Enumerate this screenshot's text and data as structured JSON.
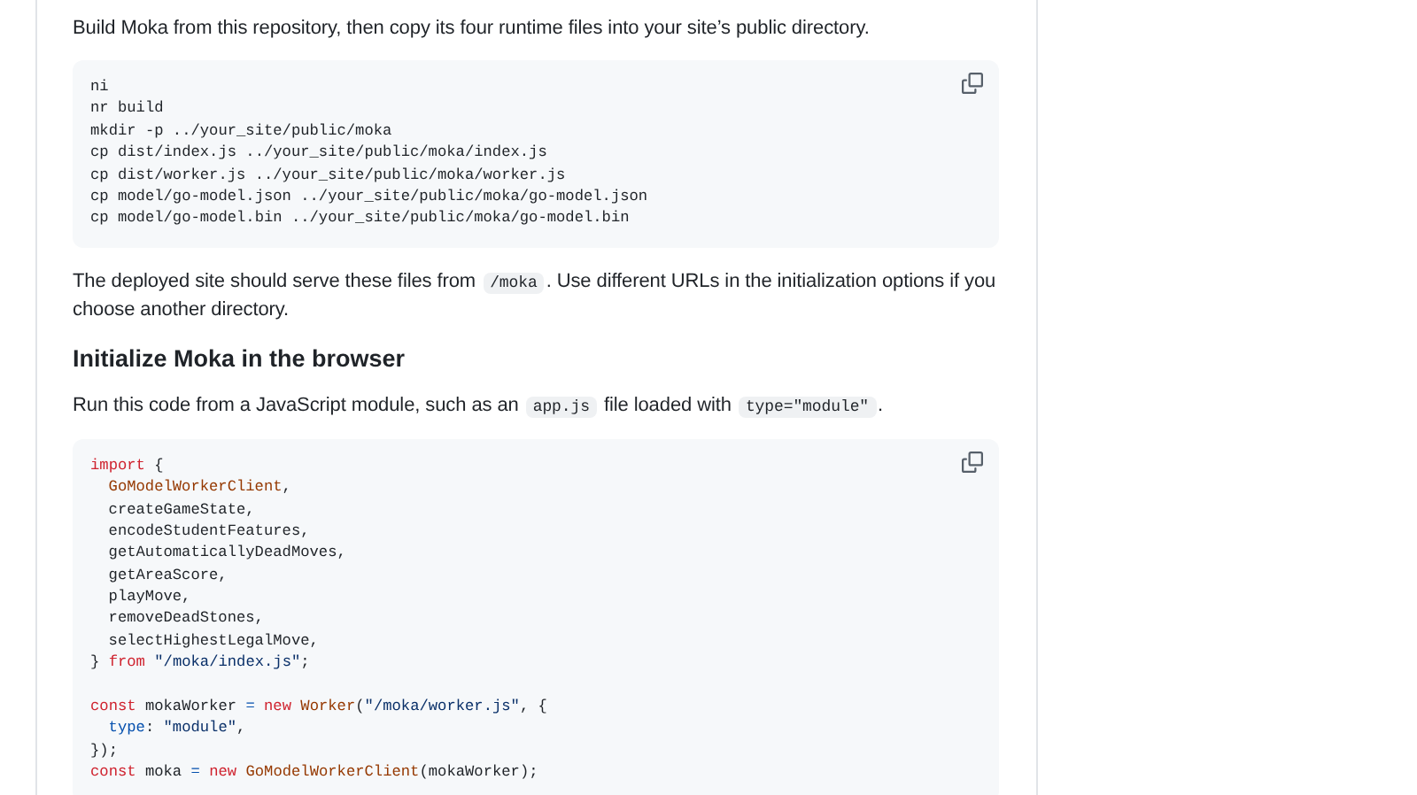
{
  "blocks": [
    {
      "kind": "paragraph",
      "segments": [
        {
          "kind": "text",
          "text": "Build Moka from this repository, then copy its four runtime files into your site’s public directory."
        }
      ]
    },
    {
      "kind": "code",
      "lines": [
        {
          "kind": "code",
          "tokens": [
            {
              "kind": "plain",
              "text": "ni"
            }
          ]
        },
        {
          "kind": "code",
          "tokens": [
            {
              "kind": "plain",
              "text": "nr build"
            }
          ]
        },
        {
          "kind": "code",
          "tokens": [
            {
              "kind": "plain",
              "text": "mkdir -p ../your_site/public/moka"
            }
          ]
        },
        {
          "kind": "code",
          "tokens": [
            {
              "kind": "plain",
              "text": "cp dist/index.js ../your_site/public/moka/index.js"
            }
          ]
        },
        {
          "kind": "code",
          "tokens": [
            {
              "kind": "plain",
              "text": "cp dist/worker.js ../your_site/public/moka/worker.js"
            }
          ]
        },
        {
          "kind": "code",
          "tokens": [
            {
              "kind": "plain",
              "text": "cp model/go-model.json ../your_site/public/moka/go-model.json"
            }
          ]
        },
        {
          "kind": "code",
          "tokens": [
            {
              "kind": "plain",
              "text": "cp model/go-model.bin ../your_site/public/moka/go-model.bin"
            }
          ]
        }
      ]
    },
    {
      "kind": "paragraph",
      "segments": [
        {
          "kind": "text",
          "text": "The deployed site should serve these files from "
        },
        {
          "kind": "code",
          "text": "/moka"
        },
        {
          "kind": "text",
          "text": ". Use different URLs in the initialization options if you choose another directory."
        }
      ]
    },
    {
      "kind": "heading",
      "text": "Initialize Moka in the browser"
    },
    {
      "kind": "paragraph",
      "segments": [
        {
          "kind": "text",
          "text": "Run this code from a JavaScript module, such as an "
        },
        {
          "kind": "code",
          "text": "app.js"
        },
        {
          "kind": "text",
          "text": " file loaded with "
        },
        {
          "kind": "code",
          "text": "type=\"module\""
        },
        {
          "kind": "text",
          "text": "."
        }
      ]
    },
    {
      "kind": "code",
      "lines": [
        {
          "kind": "code",
          "tokens": [
            {
              "kind": "keyword",
              "text": "import"
            },
            {
              "kind": "plain",
              "text": " {"
            }
          ]
        },
        {
          "kind": "code",
          "indent": true,
          "tokens": [
            {
              "kind": "entity",
              "text": "GoModelWorkerClient"
            },
            {
              "kind": "plain",
              "text": ","
            }
          ]
        },
        {
          "kind": "code",
          "indent": true,
          "tokens": [
            {
              "kind": "plain",
              "text": "createGameState,"
            }
          ]
        },
        {
          "kind": "code",
          "indent": true,
          "tokens": [
            {
              "kind": "plain",
              "text": "encodeStudentFeatures,"
            }
          ]
        },
        {
          "kind": "code",
          "indent": true,
          "tokens": [
            {
              "kind": "plain",
              "text": "getAutomaticallyDeadMoves,"
            }
          ]
        },
        {
          "kind": "code",
          "indent": true,
          "tokens": [
            {
              "kind": "plain",
              "text": "getAreaScore,"
            }
          ]
        },
        {
          "kind": "code",
          "indent": true,
          "tokens": [
            {
              "kind": "plain",
              "text": "playMove,"
            }
          ]
        },
        {
          "kind": "code",
          "indent": true,
          "tokens": [
            {
              "kind": "plain",
              "text": "removeDeadStones,"
            }
          ]
        },
        {
          "kind": "code",
          "indent": true,
          "tokens": [
            {
              "kind": "plain",
              "text": "selectHighestLegalMove,"
            }
          ]
        },
        {
          "kind": "code",
          "tokens": [
            {
              "kind": "plain",
              "text": "} "
            },
            {
              "kind": "keyword",
              "text": "from "
            },
            {
              "kind": "string",
              "text": "\"/moka/index.js\""
            },
            {
              "kind": "plain",
              "text": ";"
            }
          ]
        },
        {
          "kind": "blank"
        },
        {
          "kind": "code",
          "tokens": [
            {
              "kind": "keyword",
              "text": "const"
            },
            {
              "kind": "plain",
              "text": " mokaWorker "
            },
            {
              "kind": "operator",
              "text": "= "
            },
            {
              "kind": "keyword",
              "text": "new "
            },
            {
              "kind": "entity",
              "text": "Worker"
            },
            {
              "kind": "plain",
              "text": "("
            },
            {
              "kind": "string",
              "text": "\"/moka/worker.js\""
            },
            {
              "kind": "plain",
              "text": ", {"
            }
          ]
        },
        {
          "kind": "code",
          "indent": true,
          "tokens": [
            {
              "kind": "property",
              "text": "type"
            },
            {
              "kind": "plain",
              "text": ": "
            },
            {
              "kind": "string",
              "text": "\"module\""
            },
            {
              "kind": "plain",
              "text": ","
            }
          ]
        },
        {
          "kind": "code",
          "tokens": [
            {
              "kind": "plain",
              "text": "});"
            }
          ]
        },
        {
          "kind": "code",
          "tokens": [
            {
              "kind": "keyword",
              "text": "const"
            },
            {
              "kind": "plain",
              "text": " moka "
            },
            {
              "kind": "operator",
              "text": "= "
            },
            {
              "kind": "keyword",
              "text": "new "
            },
            {
              "kind": "entity",
              "text": "GoModelWorkerClient"
            },
            {
              "kind": "plain",
              "text": "(mokaWorker);"
            }
          ]
        }
      ]
    }
  ]
}
